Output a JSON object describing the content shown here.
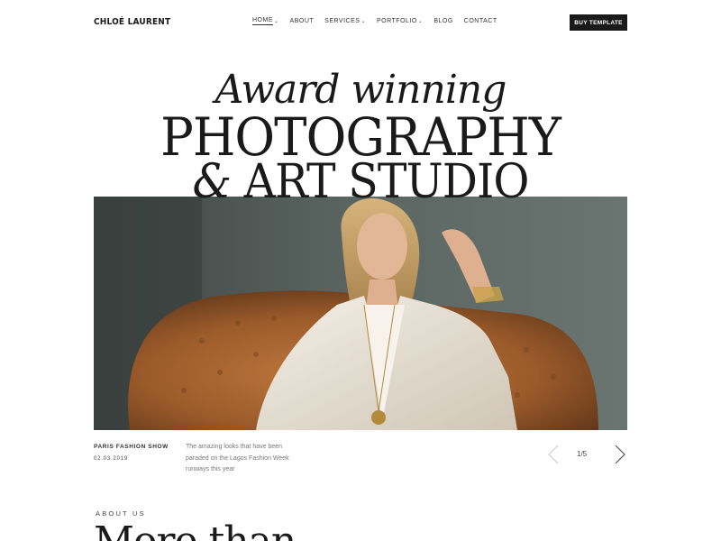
{
  "header": {
    "brand": "CHLOÉ LAURENT",
    "nav": [
      {
        "label": "HOME",
        "has_dropdown": true,
        "active": true
      },
      {
        "label": "ABOUT",
        "has_dropdown": false,
        "active": false
      },
      {
        "label": "SERVICES",
        "has_dropdown": true,
        "active": false
      },
      {
        "label": "PORTFOLIO",
        "has_dropdown": true,
        "active": false
      },
      {
        "label": "BLOG",
        "has_dropdown": false,
        "active": false
      },
      {
        "label": "CONTACT",
        "has_dropdown": false,
        "active": false
      }
    ],
    "cta_label": "BUY TEMPLATE"
  },
  "hero": {
    "line1": "Award winning",
    "line2": "PHOTOGRAPHY",
    "line3_amp": "&",
    "line3_text": "ART STUDIO"
  },
  "slide": {
    "title": "PARIS FASHION SHOW",
    "date": "02.03.2019",
    "description": "The amazing looks that have been paraded on the Lagos Fashion Week runways this year",
    "counter": "1/5"
  },
  "about": {
    "label": "ABOUT US",
    "heading": "More than"
  },
  "colors": {
    "text": "#1a1a1a",
    "button_bg": "#1a1a1a",
    "muted": "#777777",
    "sofa": "#a0612e",
    "wall": "#55605c"
  },
  "icons": {
    "prev": "chevron-left-icon",
    "next": "chevron-right-icon",
    "dropdown": "chevron-down-icon"
  }
}
